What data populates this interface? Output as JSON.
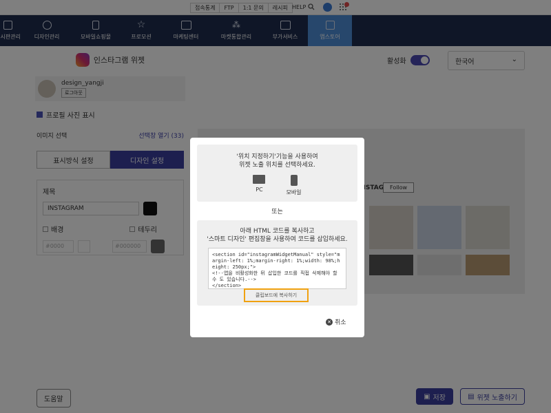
{
  "topbar": {
    "links": [
      "접속통계",
      "FTP",
      "1:1 문의",
      "레시피"
    ],
    "help_label": "HELP"
  },
  "nav": {
    "items": [
      {
        "label": "게시판관리",
        "icon": "board-icon"
      },
      {
        "label": "디자인관리",
        "icon": "palette-icon"
      },
      {
        "label": "모바일쇼핑몰",
        "icon": "mobile-icon"
      },
      {
        "label": "프로모션",
        "icon": "star-icon"
      },
      {
        "label": "마케팅센터",
        "icon": "monitor-icon"
      },
      {
        "label": "마켓통합관리",
        "icon": "network-icon"
      },
      {
        "label": "부가서비스",
        "icon": "plus-folder-icon"
      },
      {
        "label": "앱스토어",
        "icon": "apps-grid-icon",
        "active": true
      }
    ]
  },
  "left": {
    "title": "인스타그램 위젯",
    "profile_name": "design_yangji",
    "logout_label": "로그아웃",
    "show_profile_label": "프로필 사진 표시",
    "image_select_label": "이미지 선택",
    "open_select_label": "선택창 열기 (33)",
    "tabs": [
      "표시방식 설정",
      "디자인 설정"
    ],
    "title_label": "제목",
    "title_value": "INSTAGRAM",
    "bg_label": "배경",
    "border_label": "테두리",
    "bg_color": "#0000",
    "border_color": "#000000",
    "help_label": "도움말"
  },
  "right": {
    "activate_label": "활성화",
    "language": "한국어",
    "ig_title": "INSTAGRAM",
    "follow_label": "Follow",
    "save_label": "저장",
    "widget_btn_label": "위젯 노출하기"
  },
  "modal": {
    "desc1_line1": "'위치 지정하기'기능을 사용하여",
    "desc1_line2": "위젯 노출 위치를 선택하세요.",
    "pc_label": "PC",
    "mobile_label": "모바일",
    "or_label": "또는",
    "desc2_line1": "아래 HTML 코드를 복사하고",
    "desc2_line2": "'스마트 디자인' 편집창을 사용하여 코드를 삽입하세요.",
    "code": "<section id=\"instagramWidgetManual\" style=\"margin-left: 1%;margin-right: 1%;width: 98%;height: 250px;\">\n<!--앱을 비활성화한 뒤 삽입한 코드를 직접 삭제해야 할 수 도 있습니다.-->\n</section>",
    "copy_label": "클립보드에 복사하기",
    "cancel_label": "취소"
  }
}
